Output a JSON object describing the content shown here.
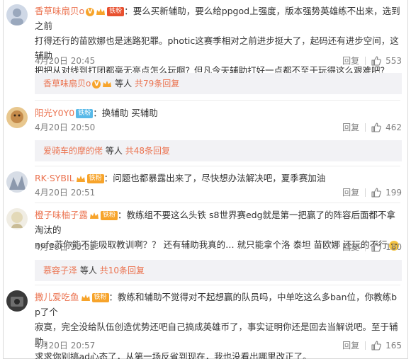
{
  "comments": [
    {
      "username": "香草味扇贝o",
      "colon": "：",
      "text_line1": "要么买新辅助，要么给ppgod上强度，版本强势英雄练不出来，选到之前",
      "text_line2": "打得还行的苗欧娜也是迷路犯罪。photic这赛季相对之前进步挺大了，起码还有进步空间，这辅助",
      "text_line3": "把把从对线到打团都毫无亮点怎么玩啊？但凡今天辅助打好一点都不至于玩得这么艰难吧？",
      "time": "4月20日 20:45",
      "reply_label": "回复",
      "likes": "553",
      "sub": {
        "username": "香草味扇贝o",
        "people": "等人",
        "more": "共79条回复"
      }
    },
    {
      "username": "阳光Y0Y0",
      "fan_badge": "铁粉",
      "colon": "：",
      "text_line1": "换辅助 买辅助",
      "time": "4月20日 20:50",
      "reply_label": "回复",
      "likes": "462",
      "sub": {
        "username": "爱骑车的摩的佬",
        "people": "等人",
        "more": "共48条回复"
      }
    },
    {
      "username": "RK·SYBIL",
      "fan_badge": "铁粉",
      "colon": "：",
      "text_line1": "问题也都暴露出来了，尽快想办法解决吧，夏季赛加油",
      "time": "4月20日 20:51",
      "reply_label": "回复",
      "likes": "199"
    },
    {
      "username": "橙子味柚子露",
      "fan_badge": "铁粉",
      "colon": "：",
      "text_line1": "教练组不要这么头铁 s8世界赛edg就是第一把赢了的阵容后面都不拿淘汰的",
      "text_line2": "nofe苏你能不能吸取教训啊？？ 还有辅助我真的… 就只能拿个洛 泰坦 苗欧娜 还玩的不行",
      "time": "4月20日 20:52",
      "reply_label": "回复",
      "likes": "180",
      "sub": {
        "username": "慕容子泽",
        "people": "等人",
        "more": "共10条回复"
      }
    },
    {
      "username": "撒儿爱吃鱼",
      "fan_badge": "铁粉",
      "colon": "：",
      "text_line1": "教练和辅助不觉得对不起想赢的队员吗，中单吃这么多ban位，你教练bp了个",
      "text_line2": "寂寞，完全没给队伍创造优势还吧自己搞成英雄币了，事实证明你还是回去当解说吧。至于辅助，",
      "text_line3": "求求你别搞ad心态了，从第一场反省到现在，我也没看出哪里改正了。",
      "time": "4月20日 20:57",
      "reply_label": "回复",
      "likes": "165"
    }
  ],
  "colors": {
    "username": "#eb7350",
    "text": "#333333",
    "meta": "#808080",
    "subbox": "#f2f2f5",
    "badge_orange": "#f7a42b",
    "badge_blue": "#58b9e8"
  }
}
